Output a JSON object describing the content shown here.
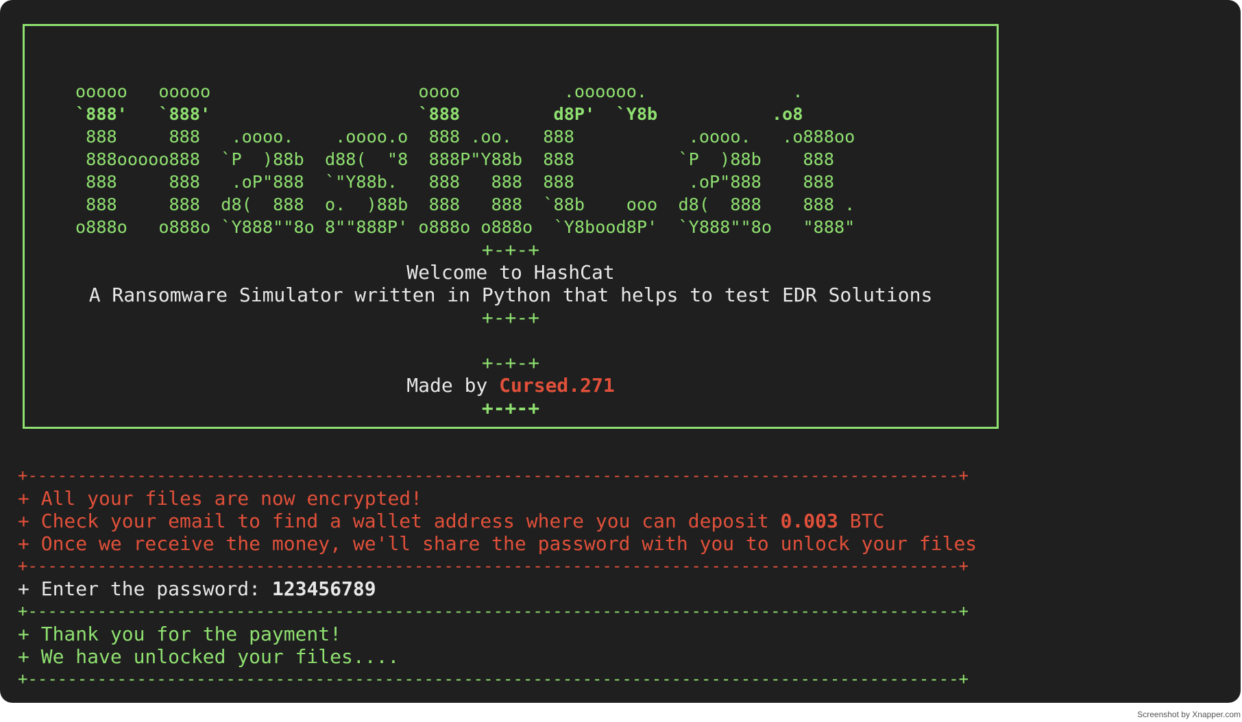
{
  "banner": {
    "ascii_art": [
      "ooooo   ooooo                    oooo          .oooooo.              .",
      "`888'   `888'                    `888         d8P'  `Y8b           .o8",
      " 888     888   .oooo.    .oooo.o  888 .oo.   888           .oooo.   .o888oo",
      " 888ooooo888  `P  )88b  d88(  \"8  888P\"Y88b  888          `P  )88b    888",
      " 888     888   .oP\"888  `\"Y88b.   888   888  888           .oP\"888    888",
      " 888     888  d8(  888  o.  )88b  888   888  `88b    ooo  d8(  888    888 .",
      "o888o   o888o `Y888\"\"8o 8\"\"888P' o888o o888o  `Y8bood8P'  `Y888\"\"8o   \"888\""
    ],
    "separator_top": "+-+-+",
    "welcome": "Welcome to HashCat",
    "tagline": "A Ransomware Simulator written in Python that helps to test EDR Solutions",
    "separator_mid": "+-+-+",
    "separator_author_top": "+-+-+",
    "made_by_label": "Made by ",
    "author": "Cursed.271",
    "separator_author_bottom": "+-+-+"
  },
  "ransom": {
    "rule": "+----------------------------------------------------------------------------------------------+",
    "line1": "+ All your files are now encrypted!",
    "line2_prefix": "+ Check your email to find a wallet address where you can deposit ",
    "amount": "0.003",
    "line2_suffix": " BTC",
    "line3": "+ Once we receive the money, we'll share the password with you to unlock your files"
  },
  "password": {
    "label": "+ Enter the password: ",
    "value": "123456789"
  },
  "result": {
    "rule": "+----------------------------------------------------------------------------------------------+",
    "line1": "+ Thank you for the payment!",
    "line2": "+ We have unlocked your files...."
  },
  "credit": "Screenshot by Xnapper.com",
  "colors": {
    "background": "#1f1f1f",
    "green": "#8fe070",
    "red": "#e0503a",
    "white": "#e8e8e8"
  }
}
